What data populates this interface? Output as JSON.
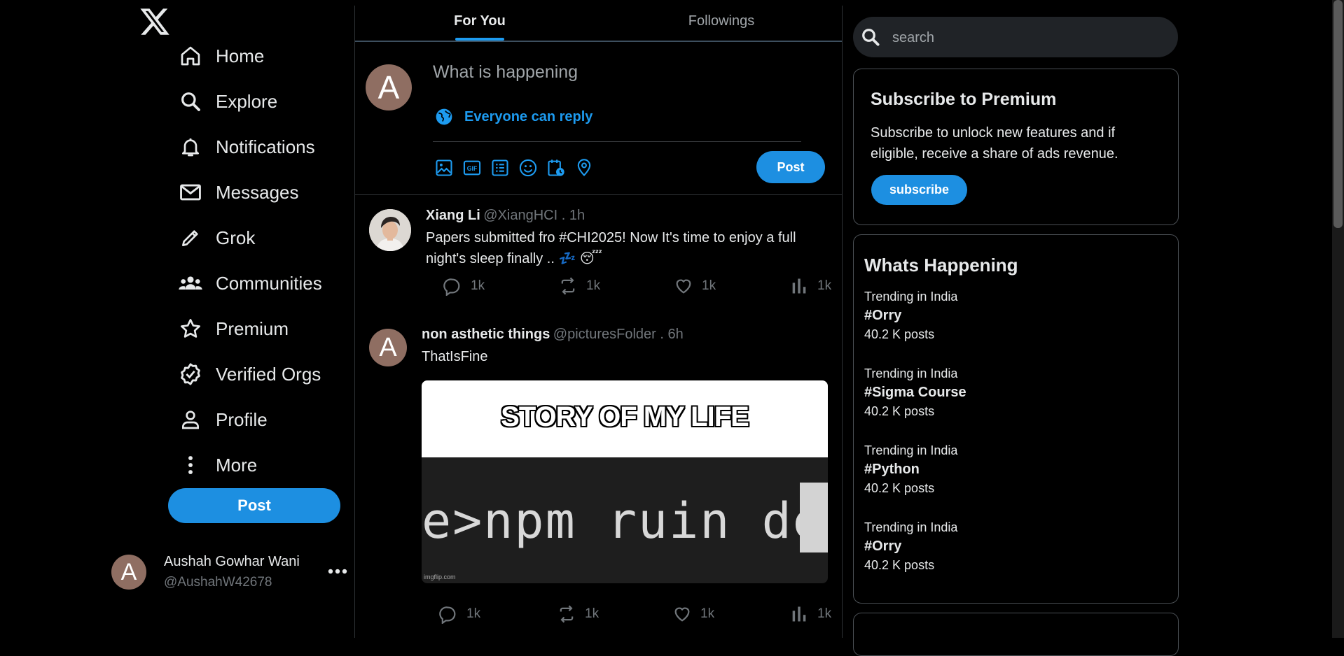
{
  "nav": {
    "items": [
      {
        "label": "Home",
        "icon": "home-icon"
      },
      {
        "label": "Explore",
        "icon": "search-icon"
      },
      {
        "label": "Notifications",
        "icon": "bell-icon"
      },
      {
        "label": "Messages",
        "icon": "mail-icon"
      },
      {
        "label": "Grok",
        "icon": "pencil-icon"
      },
      {
        "label": "Communities",
        "icon": "people-icon"
      },
      {
        "label": "Premium",
        "icon": "star-icon"
      },
      {
        "label": "Verified Orgs",
        "icon": "verified-badge-icon"
      },
      {
        "label": "Profile",
        "icon": "person-icon"
      },
      {
        "label": "More",
        "icon": "more-vertical-icon"
      }
    ],
    "post_label": "Post"
  },
  "profile": {
    "avatar_letter": "A",
    "name": "Aushah Gowhar Wani",
    "handle": "@AushahW42678"
  },
  "tabs": [
    {
      "label": "For You",
      "active": true
    },
    {
      "label": "Followings",
      "active": false
    }
  ],
  "composer": {
    "avatar_letter": "A",
    "placeholder": "What is happening",
    "reply_setting": "Everyone can reply",
    "post_label": "Post",
    "tools": [
      "image-icon",
      "gif-icon",
      "poll-icon",
      "emoji-icon",
      "schedule-icon",
      "location-icon"
    ]
  },
  "tweets": [
    {
      "name": "Xiang Li",
      "meta": "@XiangHCI . 1h",
      "text_line1": "Papers submitted fro #CHI2025! Now It's time to enjoy a full",
      "text_line2": "night's sleep finally .. 💤 😴",
      "replies": "1k",
      "retweets": "1k",
      "likes": "1k",
      "views": "1k"
    },
    {
      "avatar_letter": "A",
      "name": "non asthetic things",
      "meta": "@picturesFolder . 6h",
      "text": "ThatIsFine",
      "image_caption": "STORY OF MY LIFE",
      "image_code": "e>npm ruin dev",
      "image_watermark": "imgflip.com",
      "replies": "1k",
      "retweets": "1k",
      "likes": "1k",
      "views": "1k"
    }
  ],
  "search": {
    "placeholder": "search"
  },
  "premium": {
    "title": "Subscribe to Premium",
    "description": "Subscribe to unlock new features and if eligible, receive a share of ads revenue.",
    "button": "subscribe"
  },
  "happening": {
    "title": "Whats Happening",
    "trends": [
      {
        "context": "Trending in India",
        "tag": "#Orry",
        "count": "40.2 K posts"
      },
      {
        "context": "Trending in India",
        "tag": "#Sigma Course",
        "count": "40.2 K posts"
      },
      {
        "context": "Trending in India",
        "tag": "#Python",
        "count": "40.2 K posts"
      },
      {
        "context": "Trending in India",
        "tag": "#Orry",
        "count": "40.2 K posts"
      }
    ]
  },
  "colors": {
    "accent": "#1d9bf0",
    "button": "#1d8fe1",
    "avatar": "#8f6e62",
    "background": "#000000",
    "muted_text": "#71767b"
  }
}
